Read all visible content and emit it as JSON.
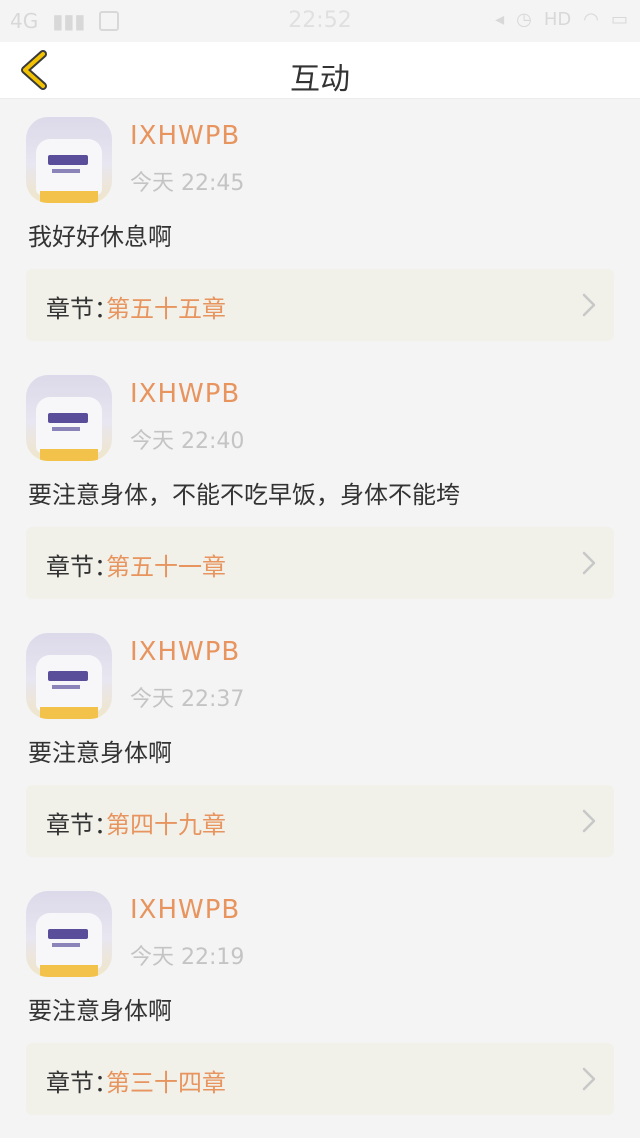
{
  "status_bar": {
    "network": "4G",
    "time": "22:52",
    "hd": "HD"
  },
  "header": {
    "title": "互动"
  },
  "comments": [
    {
      "username": "IXHWPB",
      "time": "今天 22:45",
      "text": "我好好休息啊",
      "chapter_label": "章节：",
      "chapter_name": "第五十五章"
    },
    {
      "username": "IXHWPB",
      "time": "今天 22:40",
      "text": "要注意身体，不能不吃早饭，身体不能垮",
      "chapter_label": "章节：",
      "chapter_name": "第五十一章"
    },
    {
      "username": "IXHWPB",
      "time": "今天 22:37",
      "text": "要注意身体啊",
      "chapter_label": "章节：",
      "chapter_name": "第四十九章"
    },
    {
      "username": "IXHWPB",
      "time": "今天 22:19",
      "text": "要注意身体啊",
      "chapter_label": "章节：",
      "chapter_name": "第三十四章"
    }
  ],
  "colors": {
    "accent": "#e8945e",
    "back_icon": "#f2c200",
    "card_bg": "#f1f1ea"
  }
}
